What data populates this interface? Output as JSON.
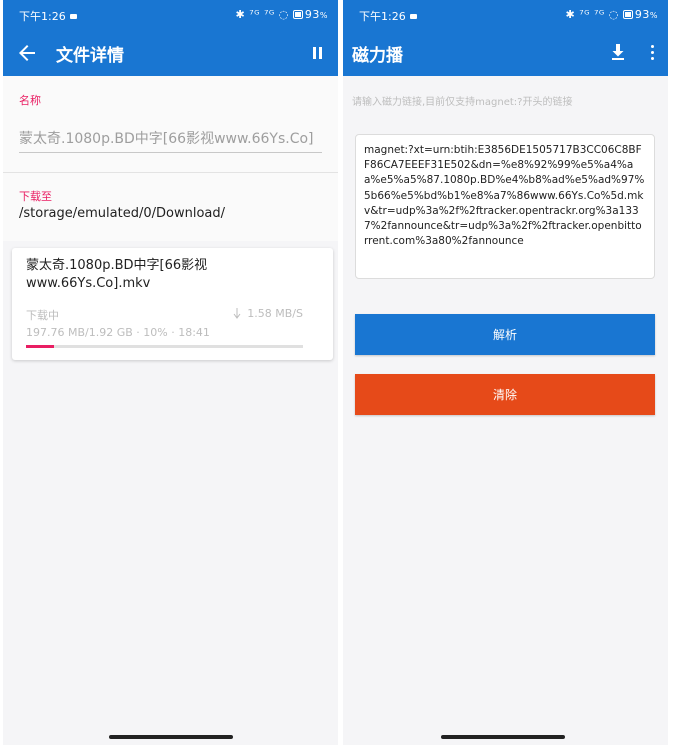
{
  "left_screen": {
    "status": {
      "time": "下午1:26",
      "signal": "✱ ⁷ᴳ ⁷ᴳ ◌",
      "battery": "93"
    },
    "appbar": {
      "title": "文件详情",
      "back_icon": "arrow-left-icon",
      "pause_icon": "pause-icon"
    },
    "name_section": {
      "label": "名称",
      "value": "蒙太奇.1080p.BD中字[66影视www.66Ys.Co]"
    },
    "path_section": {
      "label": "下载至",
      "value": "/storage/emulated/0/Download/"
    },
    "task": {
      "filename": "蒙太奇.1080p.BD中字[66影视www.66Ys.Co].mkv",
      "status": "下载中",
      "speed": "1.58 MB/S",
      "meta": "197.76 MB/1.92 GB · 10% · 18:41",
      "progress_percent": 10
    }
  },
  "right_screen": {
    "status": {
      "time": "下午1:26",
      "signal": "✱ ⁷ᴳ ⁷ᴳ ◌",
      "battery": "93"
    },
    "appbar": {
      "title": "磁力播",
      "download_icon": "download-icon",
      "more_icon": "more-vert-icon"
    },
    "hint": "请输入磁力链接,目前仅支持magnet:?开头的链接",
    "magnet": "magnet:?xt=urn:btih:E3856DE1505717B3CC06C8BFF86CA7EEEF31E502&dn=%e8%92%99%e5%a4%aa%e5%a5%87.1080p.BD%e4%b8%ad%e5%ad%97%5b66%e5%bd%b1%e8%a7%86www.66Ys.Co%5d.mkv&tr=udp%3a%2f%2ftracker.opentrackr.org%3a1337%2fannounce&tr=udp%3a%2f%2ftracker.openbittorrent.com%3a80%2fannounce",
    "parse_label": "解析",
    "clear_label": "清除"
  },
  "colors": {
    "primary": "#1976d2",
    "accent": "#e91e63",
    "danger": "#e64a19"
  }
}
